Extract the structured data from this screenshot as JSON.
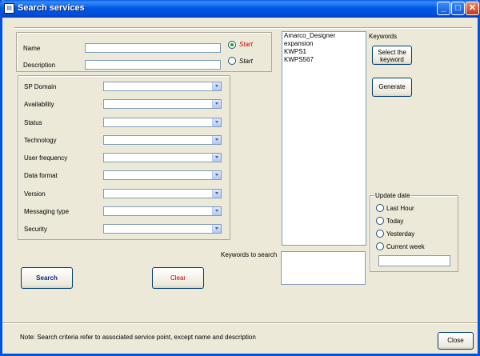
{
  "window": {
    "title": "Search services"
  },
  "titlebar_buttons": {
    "minimize": "_",
    "maximize": "□",
    "close": "✕"
  },
  "name_field": {
    "label": "Name",
    "value": ""
  },
  "description_field": {
    "label": "Description",
    "value": ""
  },
  "match_mode": {
    "start_label": "Start",
    "start2_label": "Start",
    "selected": "Start (name)"
  },
  "filters": [
    {
      "label": "SP Domain",
      "value": ""
    },
    {
      "label": "Availability",
      "value": ""
    },
    {
      "label": "Status",
      "value": ""
    },
    {
      "label": "Technology",
      "value": ""
    },
    {
      "label": "User frequency",
      "value": ""
    },
    {
      "label": "Data format",
      "value": ""
    },
    {
      "label": "Version",
      "value": ""
    },
    {
      "label": "Messaging type",
      "value": ""
    },
    {
      "label": "Security",
      "value": ""
    }
  ],
  "keywords_list": [
    "Amarco_Designer",
    "expansion",
    "KWPS1",
    "KWPS567"
  ],
  "keywords": {
    "label": "Keywords",
    "select_button": "Select the keyword",
    "generate_button": "Generate"
  },
  "keywords_to_search": {
    "label": "Keywords to search",
    "value": ""
  },
  "update_date": {
    "legend": "Update date",
    "options": [
      "Last Hour",
      "Today",
      "Yesterday",
      "Current week"
    ],
    "custom_value": ""
  },
  "actions": {
    "search": "Search",
    "clear": "Clear",
    "close": "Close"
  },
  "colors": {
    "search": "#0b2b8f",
    "clear": "#c00000",
    "start_red": "#d00000"
  },
  "note": "Note: Search criteria refer to associated service point, except name and description"
}
